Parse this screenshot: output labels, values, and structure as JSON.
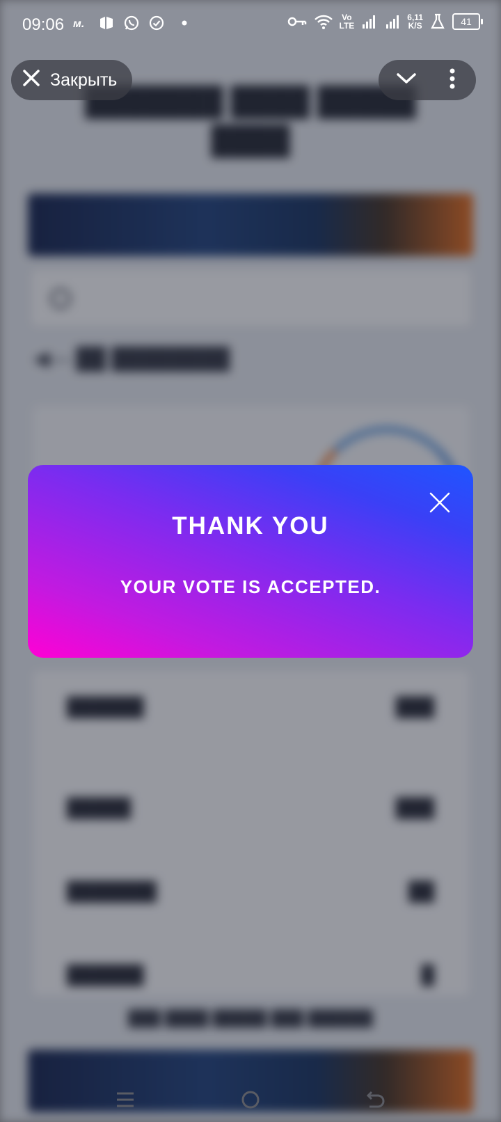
{
  "status_bar": {
    "time": "09:06",
    "left_icons": [
      "mts-icon",
      "notification-app-icon",
      "whatsapp-icon",
      "check-circle-icon",
      "dot-icon"
    ],
    "net_type_top": "Vo",
    "net_type_bottom": "LTE",
    "speed_value": "6,11",
    "speed_unit": "K/S",
    "battery": "41"
  },
  "top_bar": {
    "close_label": "Закрыть",
    "collapse_icon": "chevron-down-icon",
    "menu_icon": "more-vertical-icon"
  },
  "modal": {
    "title": "THANK YOU",
    "message": "YOUR VOTE IS ACCEPTED.",
    "close_icon": "close-icon"
  },
  "nav_bar": {
    "icons": [
      "recents-icon",
      "home-icon",
      "back-icon"
    ]
  },
  "colors": {
    "modal_gradient_start": "#ff00d4",
    "modal_gradient_end": "#1f55ff"
  }
}
